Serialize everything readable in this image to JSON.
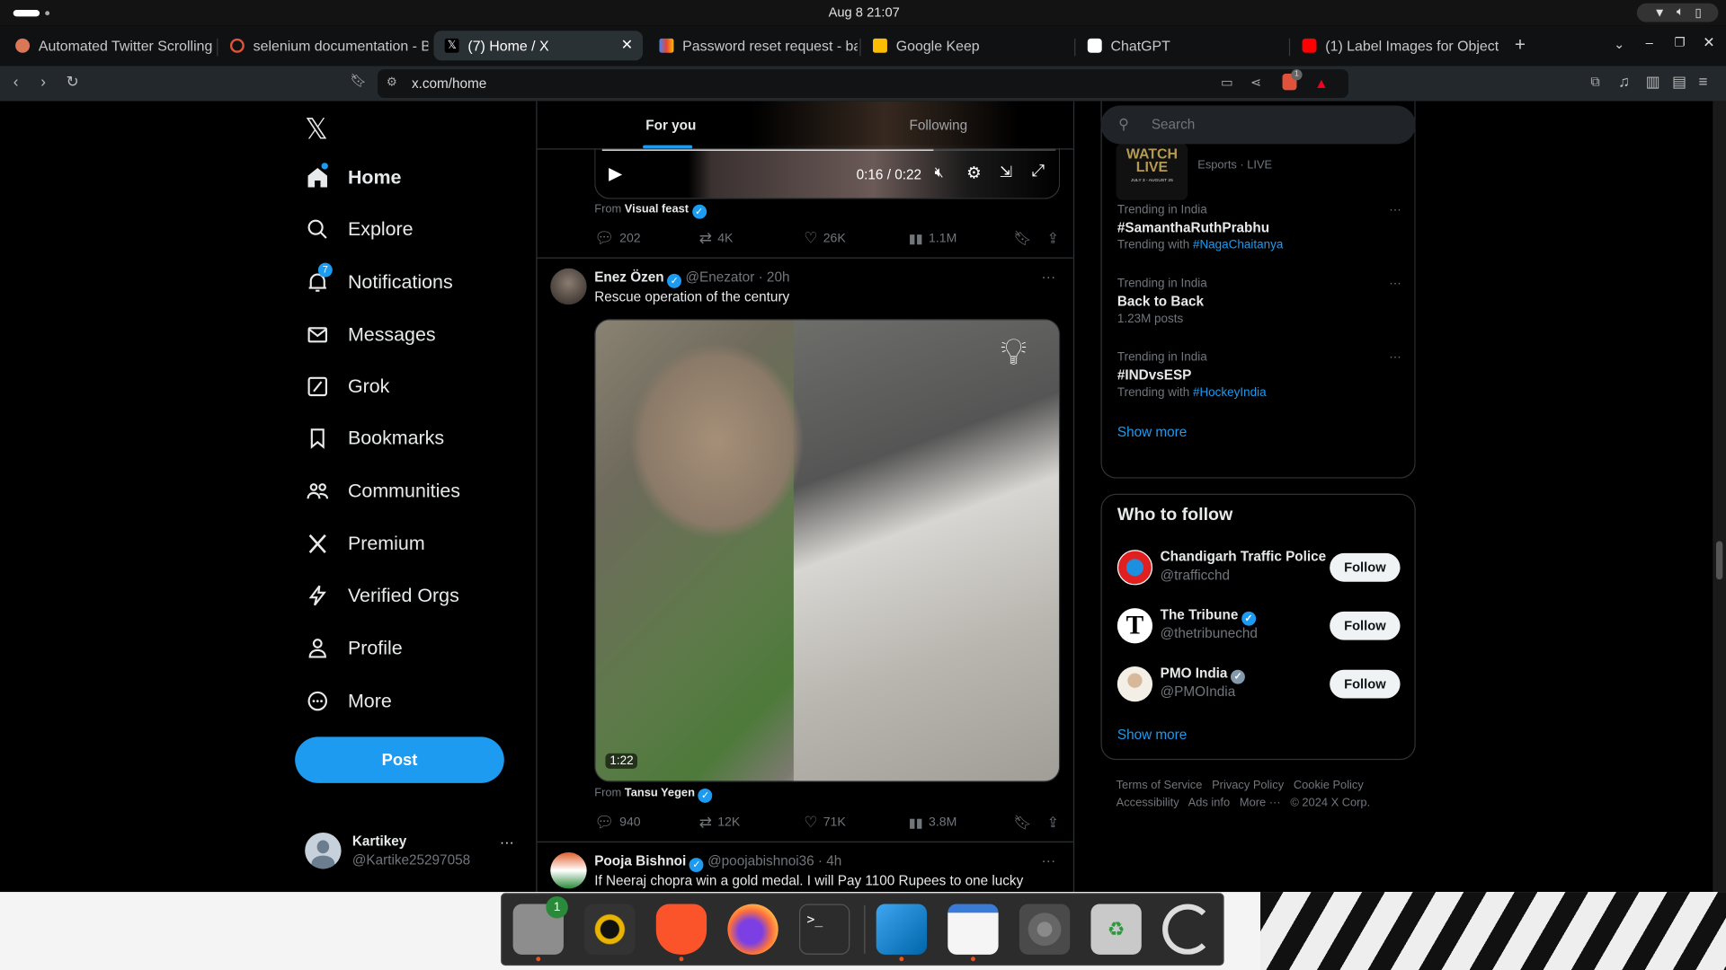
{
  "system": {
    "datetime": "Aug 8  21:07"
  },
  "browser": {
    "tabs": [
      {
        "title": "Automated Twitter Scrolling",
        "active": false,
        "icon": "claude-icon"
      },
      {
        "title": "selenium documentation - B",
        "active": false,
        "icon": "brave-search-icon"
      },
      {
        "title": "(7) Home / X",
        "active": true,
        "icon": "x-icon"
      },
      {
        "title": "Password reset request - ba",
        "active": false,
        "icon": "gmail-icon"
      },
      {
        "title": "Google Keep",
        "active": false,
        "icon": "keep-icon"
      },
      {
        "title": "ChatGPT",
        "active": false,
        "icon": "chatgpt-icon"
      },
      {
        "title": "(1) Label Images for Object",
        "active": false,
        "icon": "youtube-icon"
      }
    ],
    "url": "x.com/home",
    "shields_badge": "1"
  },
  "sidebar": {
    "items": [
      {
        "label": "Home",
        "icon": "home-icon",
        "active": true
      },
      {
        "label": "Explore",
        "icon": "search-icon"
      },
      {
        "label": "Notifications",
        "icon": "bell-icon",
        "badge": "7"
      },
      {
        "label": "Messages",
        "icon": "mail-icon"
      },
      {
        "label": "Grok",
        "icon": "grok-icon"
      },
      {
        "label": "Bookmarks",
        "icon": "bookmark-icon"
      },
      {
        "label": "Communities",
        "icon": "people-icon"
      },
      {
        "label": "Premium",
        "icon": "x-icon"
      },
      {
        "label": "Verified Orgs",
        "icon": "lightning-icon"
      },
      {
        "label": "Profile",
        "icon": "person-icon"
      },
      {
        "label": "More",
        "icon": "more-circle-icon"
      }
    ],
    "post_label": "Post",
    "account": {
      "name": "Kartikey",
      "handle": "@Kartike25297058"
    }
  },
  "feed": {
    "tabs": [
      {
        "label": "For you",
        "active": true
      },
      {
        "label": "Following",
        "active": false
      }
    ],
    "posts": [
      {
        "video_time": "0:16 / 0:22",
        "video_progress": 0.73,
        "from_label": "From",
        "from": "Visual feast",
        "replies": "202",
        "reposts": "4K",
        "likes": "26K",
        "views": "1.1M"
      },
      {
        "name": "Enez Özen",
        "handle": "@Enezator",
        "time": "· 20h",
        "text": "Rescue operation of the century",
        "duration": "1:22",
        "from_label": "From",
        "from": "Tansu Yegen",
        "replies": "940",
        "reposts": "12K",
        "likes": "71K",
        "views": "3.8M"
      },
      {
        "name": "Pooja Bishnoi",
        "handle": "@poojabishnoi36",
        "time": "· 4h",
        "text": "If Neeraj chopra win a gold medal. I will Pay 1100 Rupees to one lucky"
      }
    ]
  },
  "right": {
    "search_placeholder": "Search",
    "event": {
      "meta": "Esports · LIVE",
      "thumb_title": "WATCH LIVE",
      "thumb_dates": "JULY 3 - AUGUST 25"
    },
    "trends": [
      {
        "context": "Trending in India",
        "title": "#SamanthaRuthPrabhu",
        "sub": "Trending with",
        "link": "#NagaChaitanya"
      },
      {
        "context": "Trending in India",
        "title": "Back to Back",
        "sub": "1.23M posts",
        "link": ""
      },
      {
        "context": "Trending in India",
        "title": "#INDvsESP",
        "sub": "Trending with",
        "link": "#HockeyIndia"
      }
    ],
    "show_more": "Show more",
    "who_to_follow": {
      "title": "Who to follow",
      "accounts": [
        {
          "name": "Chandigarh Traffic Police",
          "handle": "@trafficchd",
          "verified": false
        },
        {
          "name": "The Tribune",
          "handle": "@thetribunechd",
          "verified": true
        },
        {
          "name": "PMO India",
          "handle": "@PMOIndia",
          "verified": true
        }
      ],
      "follow_label": "Follow",
      "show_more": "Show more"
    },
    "footer": [
      "Terms of Service",
      "Privacy Policy",
      "Cookie Policy",
      "Accessibility",
      "Ads info",
      "More ···",
      "© 2024 X Corp."
    ]
  },
  "dock": {
    "files_badge": "1",
    "terminal_glyph": ">_"
  },
  "colors": {
    "accent": "#1d9bf0",
    "background": "#000000",
    "border": "#2f3336",
    "muted": "#71767b"
  }
}
